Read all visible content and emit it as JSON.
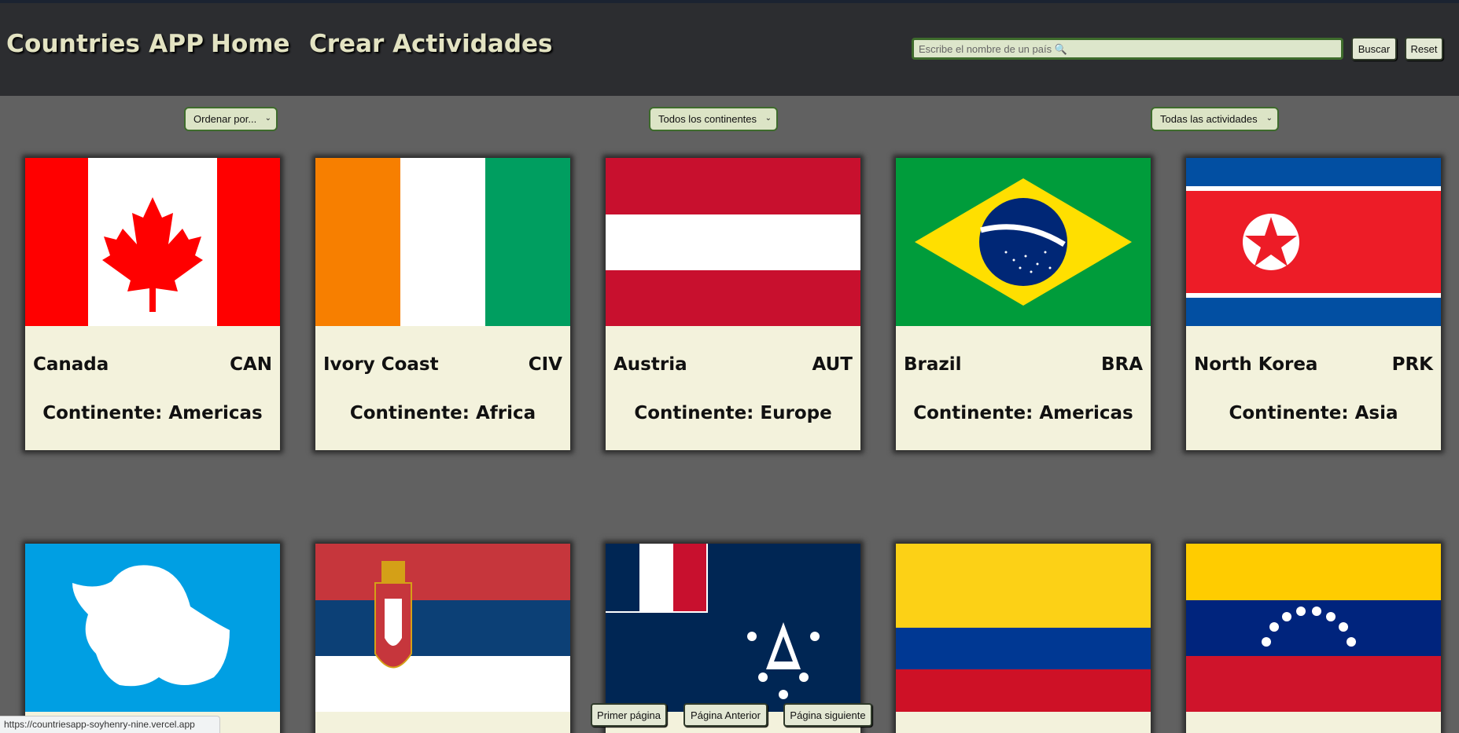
{
  "header": {
    "brand": "Countries APP",
    "nav": {
      "home": "Home",
      "crear": "Crear Actividades"
    },
    "search": {
      "placeholder": "Escribe el nombre de un país 🔍"
    },
    "buttons": {
      "buscar": "Buscar",
      "reset": "Reset"
    }
  },
  "filters": {
    "order": "Ordenar por...",
    "continent": "Todos los continentes",
    "activity": "Todas las actividades"
  },
  "cards_row1": [
    {
      "name": "Canada",
      "code": "CAN",
      "continent": "Continente: Americas"
    },
    {
      "name": "Ivory Coast",
      "code": "CIV",
      "continent": "Continente: Africa"
    },
    {
      "name": "Austria",
      "code": "AUT",
      "continent": "Continente: Europe"
    },
    {
      "name": "Brazil",
      "code": "BRA",
      "continent": "Continente: Americas"
    },
    {
      "name": "North Korea",
      "code": "PRK",
      "continent": "Continente: Asia"
    }
  ],
  "flags_row2": [
    "antarctica-flag",
    "serbia-flag",
    "french-southern-territories-flag",
    "colombia-flag",
    "venezuela-flag"
  ],
  "pagination": {
    "first": "Primer página",
    "prev": "Página Anterior",
    "next": "Página siguiente"
  },
  "statusbar": {
    "url": "https://countriesapp-soyhenry-nine.vercel.app"
  },
  "colors": {
    "header_bg": "#2c2d30",
    "page_bg": "#616161",
    "card_bg": "#f3f2dc",
    "accent_green": "#3e6b2c",
    "brand_text": "#e3e3c2"
  }
}
